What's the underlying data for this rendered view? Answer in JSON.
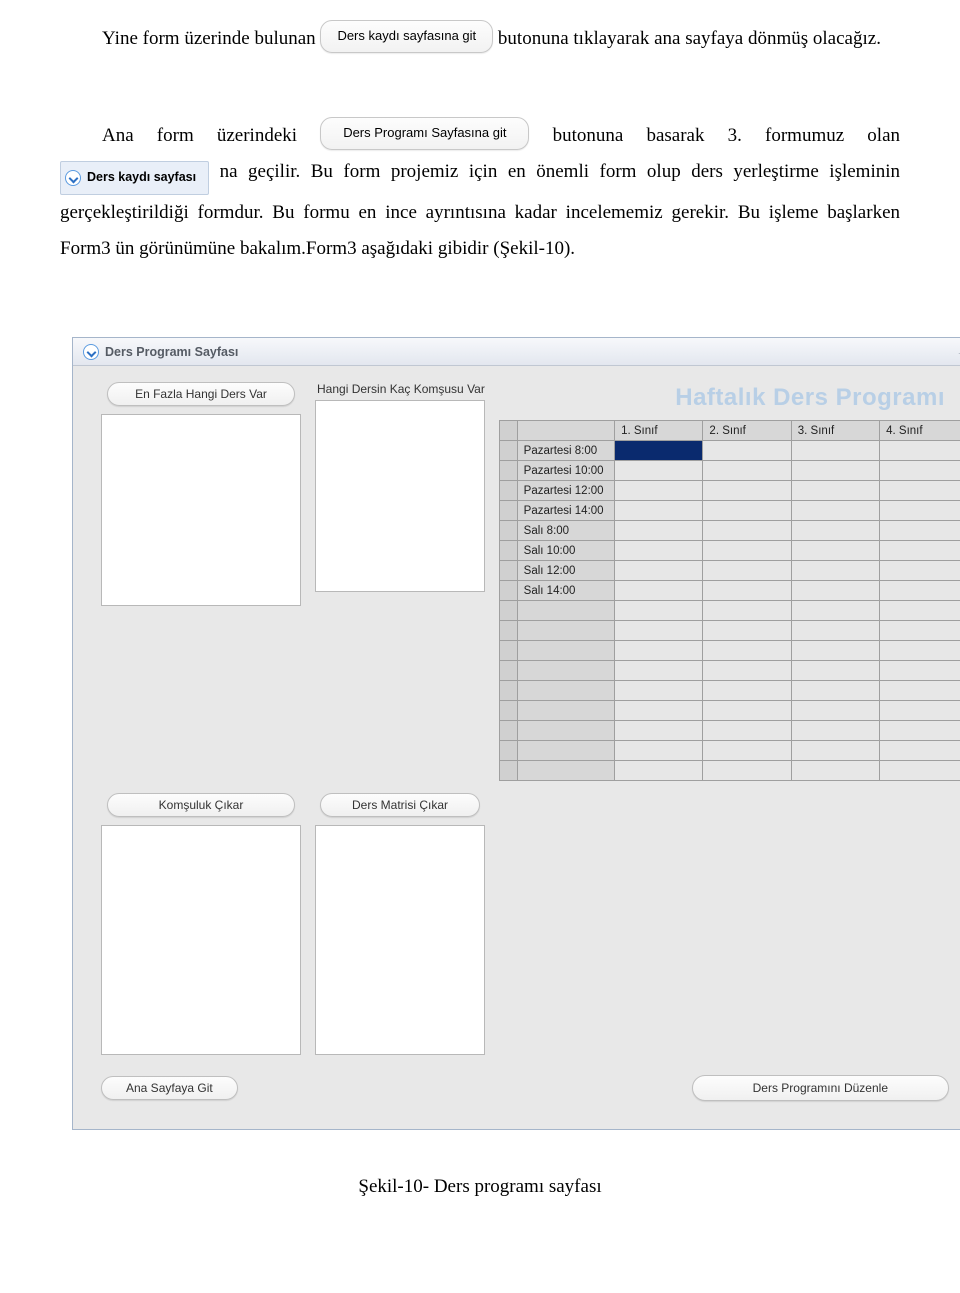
{
  "doc": {
    "p1_before": "Yine form üzerinde bulunan ",
    "btn1": "Ders kaydı sayfasına git",
    "p1_after": " butonuna tıklayarak ana sayfaya dönmüş olacağız.",
    "p2_before": "Ana form üzerindeki ",
    "btn2": "Ders Programı Sayfasına git",
    "p2_after": " butonuna  basarak 3. formumuz olan ",
    "tab_label": "Ders kaydı sayfası",
    "p3_rest": " na geçilir. Bu form projemiz için en önemli form olup ders yerleştirme işleminin gerçekleştirildiği formdur. Bu formu en ince ayrıntısına kadar incelememiz gerekir. Bu işleme başlarken Form3 ün görünümüne bakalım.Form3 aşağıdaki gibidir (Şekil-10)."
  },
  "window": {
    "title": "Ders Programı Sayfası",
    "headline": "Haftalık Ders Programı",
    "btn_en_fazla": "En Fazla Hangi Ders Var",
    "lbl_komsu": "Hangi Dersin Kaç Komşusu Var",
    "btn_komsuluk": "Komşuluk Çıkar",
    "btn_matris": "Ders Matrisi Çıkar",
    "btn_duzenle": "Ders Programını Düzenle",
    "btn_ana": "Ana Sayfaya Git",
    "columns": [
      "1. Sınıf",
      "2. Sınıf",
      "3. Sınıf",
      "4. Sınıf"
    ],
    "rows": [
      "Pazartesi 8:00",
      "Pazartesi 10:00",
      "Pazartesi 12:00",
      "Pazartesi 14:00",
      "Salı  8:00",
      "Salı 10:00",
      "Salı 12:00",
      "Salı 14:00",
      "",
      "",
      "",
      "",
      "",
      "",
      "",
      "",
      ""
    ]
  },
  "caption": "Şekil-10- Ders programı sayfası"
}
